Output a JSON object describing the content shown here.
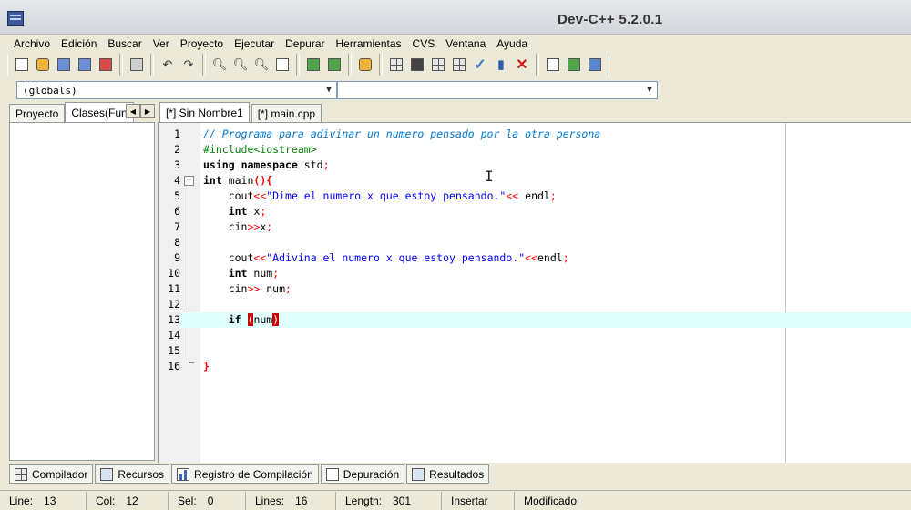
{
  "window": {
    "title": "Dev-C++ 5.2.0.1"
  },
  "menu": [
    "Archivo",
    "Edición",
    "Buscar",
    "Ver",
    "Proyecto",
    "Ejecutar",
    "Depurar",
    "Herramientas",
    "CVS",
    "Ventana",
    "Ayuda"
  ],
  "toolbar": {
    "icons": [
      "new-file-icon",
      "open-file-icon",
      "save-icon",
      "save-all-icon",
      "close-file-icon",
      "print-icon",
      "undo-icon",
      "redo-icon",
      "find-icon",
      "replace-icon",
      "find-next-icon",
      "goto-line-icon",
      "add-to-project-icon",
      "remove-from-project-icon",
      "project-options-icon",
      "compile-icon",
      "run-icon",
      "compile-run-icon",
      "rebuild-icon",
      "syntax-check-icon",
      "profile-icon",
      "stop-icon",
      "new-class-icon",
      "insert-icon",
      "toggle-bookmark-icon"
    ]
  },
  "scope_dropdown": {
    "value": "(globals)"
  },
  "member_dropdown": {
    "value": ""
  },
  "left_panel": {
    "tabs": [
      {
        "label": "Proyecto",
        "active": false
      },
      {
        "label": "Clases(Fun",
        "active": true
      }
    ]
  },
  "editor": {
    "tabs": [
      {
        "label": "[*] Sin Nombre1",
        "active": true
      },
      {
        "label": "[*] main.cpp",
        "active": false
      }
    ],
    "current_line": 13,
    "lines": [
      {
        "n": "1",
        "text": "// Programa para adivinar un numero pensado por la otra persona"
      },
      {
        "n": "2",
        "text": "#include<iostream>"
      },
      {
        "n": "3",
        "text": "using namespace std;"
      },
      {
        "n": "4",
        "text": "int main(){"
      },
      {
        "n": "5",
        "text": "    cout<<\"Dime el numero x que estoy pensando.\"<< endl;"
      },
      {
        "n": "6",
        "text": "    int x;"
      },
      {
        "n": "7",
        "text": "    cin>>x;"
      },
      {
        "n": "8",
        "text": ""
      },
      {
        "n": "9",
        "text": "    cout<<\"Adivina el numero x que estoy pensando.\"<<endl;"
      },
      {
        "n": "10",
        "text": "    int num;"
      },
      {
        "n": "11",
        "text": "    cin>> num;"
      },
      {
        "n": "12",
        "text": ""
      },
      {
        "n": "13",
        "text": "    if (num)"
      },
      {
        "n": "14",
        "text": ""
      },
      {
        "n": "15",
        "text": ""
      },
      {
        "n": "16",
        "text": "}"
      }
    ]
  },
  "bottom_tabs": [
    {
      "label": "Compilador",
      "icon": "compiler-grid-icon"
    },
    {
      "label": "Recursos",
      "icon": "resources-icon"
    },
    {
      "label": "Registro de Compilación",
      "icon": "compile-log-chart-icon"
    },
    {
      "label": "Depuración",
      "icon": "debug-check-icon"
    },
    {
      "label": "Resultados",
      "icon": "results-find-icon"
    }
  ],
  "status": {
    "line_label": "Line:",
    "line_value": "13",
    "col_label": "Col:",
    "col_value": "12",
    "sel_label": "Sel:",
    "sel_value": "0",
    "lines_label": "Lines:",
    "lines_value": "16",
    "length_label": "Length:",
    "length_value": "301",
    "mode": "Insertar",
    "state": "Modificado"
  }
}
